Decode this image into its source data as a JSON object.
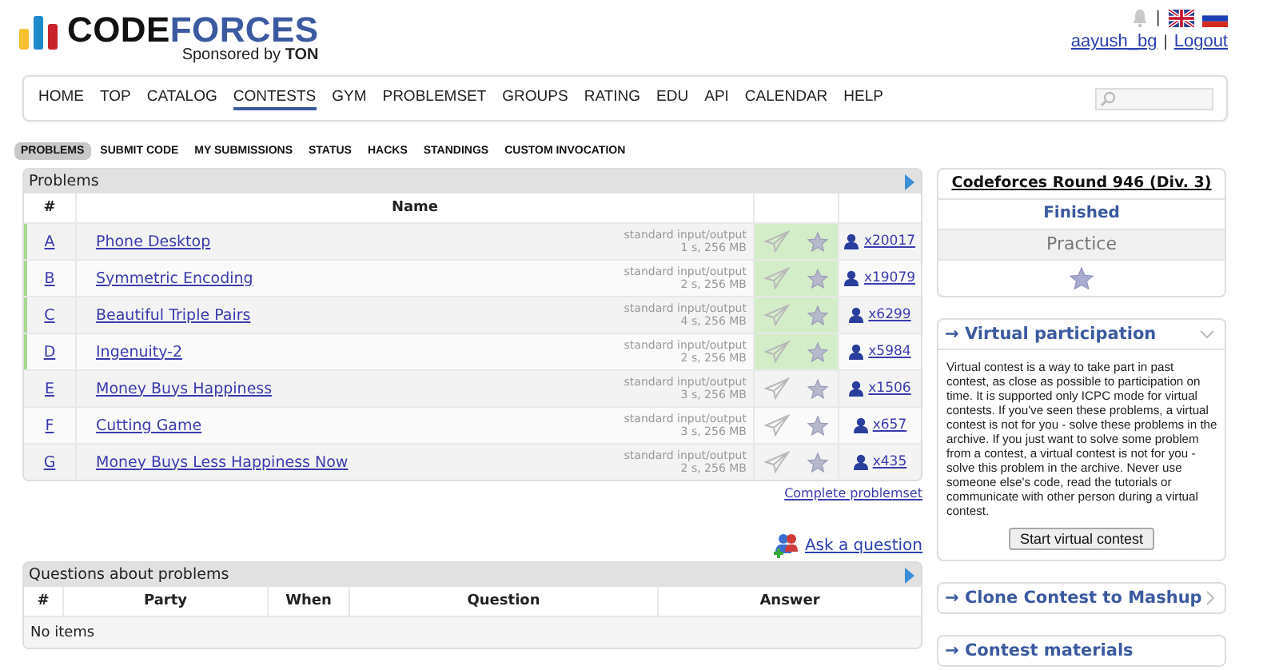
{
  "header": {
    "logo": {
      "part_1": "CODE",
      "part_2": "FORCES",
      "sponsor_1": "Sponsored by",
      "sponsor_2": "TON"
    },
    "separator": "|",
    "user_links": [
      {
        "label": "aayush_bg"
      },
      {
        "label": "Logout"
      }
    ],
    "user_separator": "|"
  },
  "nav": [
    {
      "label": "HOME",
      "selected": false
    },
    {
      "label": "TOP",
      "selected": false
    },
    {
      "label": "CATALOG",
      "selected": false
    },
    {
      "label": "CONTESTS",
      "selected": true
    },
    {
      "label": "GYM",
      "selected": false
    },
    {
      "label": "PROBLEMSET",
      "selected": false
    },
    {
      "label": "GROUPS",
      "selected": false
    },
    {
      "label": "RATING",
      "selected": false
    },
    {
      "label": "EDU",
      "selected": false
    },
    {
      "label": "API",
      "selected": false
    },
    {
      "label": "CALENDAR",
      "selected": false
    },
    {
      "label": "HELP",
      "selected": false
    }
  ],
  "subnav": [
    {
      "label": "PROBLEMS",
      "selected": true
    },
    {
      "label": "SUBMIT CODE",
      "selected": false
    },
    {
      "label": "MY SUBMISSIONS",
      "selected": false
    },
    {
      "label": "STATUS",
      "selected": false
    },
    {
      "label": "HACKS",
      "selected": false
    },
    {
      "label": "STANDINGS",
      "selected": false
    },
    {
      "label": "CUSTOM INVOCATION",
      "selected": false
    }
  ],
  "problems": {
    "title": "Problems",
    "columns": [
      "#",
      "Name"
    ],
    "rows": [
      {
        "index": "A",
        "name": "Phone Desktop",
        "io": "standard input/output",
        "limits": "1 s, 256 MB",
        "solved": true,
        "count": "x20017"
      },
      {
        "index": "B",
        "name": "Symmetric Encoding",
        "io": "standard input/output",
        "limits": "2 s, 256 MB",
        "solved": true,
        "count": "x19079"
      },
      {
        "index": "C",
        "name": "Beautiful Triple Pairs",
        "io": "standard input/output",
        "limits": "4 s, 256 MB",
        "solved": true,
        "count": "x6299"
      },
      {
        "index": "D",
        "name": "Ingenuity-2",
        "io": "standard input/output",
        "limits": "2 s, 256 MB",
        "solved": true,
        "count": "x5984"
      },
      {
        "index": "E",
        "name": "Money Buys Happiness",
        "io": "standard input/output",
        "limits": "3 s, 256 MB",
        "solved": false,
        "count": "x1506"
      },
      {
        "index": "F",
        "name": "Cutting Game",
        "io": "standard input/output",
        "limits": "3 s, 256 MB",
        "solved": false,
        "count": "x657"
      },
      {
        "index": "G",
        "name": "Money Buys Less Happiness Now",
        "io": "standard input/output",
        "limits": "2 s, 256 MB",
        "solved": false,
        "count": "x435"
      }
    ],
    "footer_link": "Complete problemset"
  },
  "ask_link": "Ask a question",
  "questions": {
    "title": "Questions about problems",
    "columns": [
      "#",
      "Party",
      "When",
      "Question",
      "Answer"
    ],
    "empty": "No items"
  },
  "sidebar": {
    "contest": {
      "name": "Codeforces Round 946 (Div. 3)",
      "status": "Finished",
      "phase": "Practice"
    },
    "virtual": {
      "title": "→ Virtual participation",
      "collapsed": false,
      "text": "Virtual contest is a way to take part in past contest, as close as possible to participation on time. It is supported only ICPC mode for virtual contests. If you've seen these problems, a virtual contest is not for you - solve these problems in the archive. If you just want to solve some problem from a contest, a virtual contest is not for you - solve this problem in the archive. Never use someone else's code, read the tutorials or communicate with other person during a virtual contest.",
      "button": "Start virtual contest"
    },
    "boxes": [
      {
        "title": "→ Clone Contest to Mashup",
        "collapsed": true
      },
      {
        "title": "→ Contest materials"
      }
    ]
  }
}
